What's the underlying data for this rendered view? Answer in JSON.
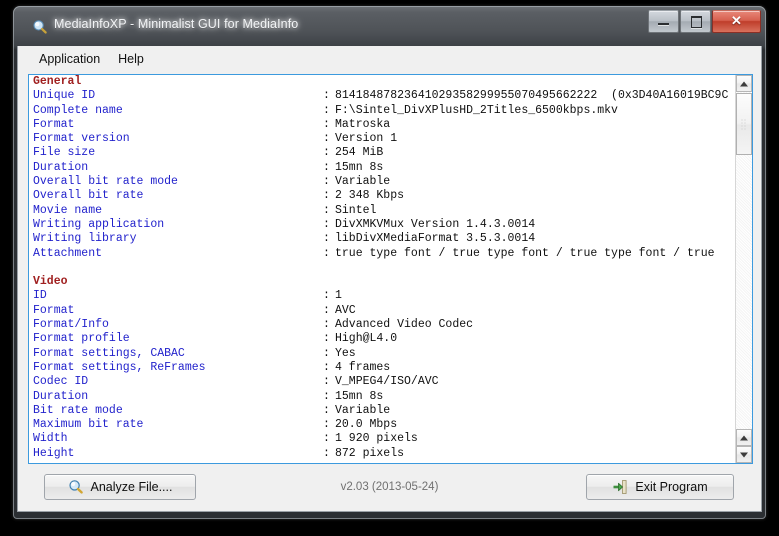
{
  "window": {
    "title": "MediaInfoXP - Minimalist GUI for MediaInfo",
    "app_icon": "magnifier-icon",
    "controls": {
      "minimize_label": "–",
      "maximize_label": "□",
      "close_label": "✕"
    }
  },
  "menubar": {
    "items": [
      {
        "label": "Application"
      },
      {
        "label": "Help"
      }
    ]
  },
  "report": {
    "separator": ":",
    "sections": [
      {
        "name": "General",
        "rows": [
          {
            "label": "Unique ID",
            "value": "81418487823641029358299955070495662222  (0x3D40A16019BC9C"
          },
          {
            "label": "Complete name",
            "value": "F:\\Sintel_DivXPlusHD_2Titles_6500kbps.mkv"
          },
          {
            "label": "Format",
            "value": "Matroska"
          },
          {
            "label": "Format version",
            "value": "Version 1"
          },
          {
            "label": "File size",
            "value": "254 MiB"
          },
          {
            "label": "Duration",
            "value": "15mn 8s"
          },
          {
            "label": "Overall bit rate mode",
            "value": "Variable"
          },
          {
            "label": "Overall bit rate",
            "value": "2 348 Kbps"
          },
          {
            "label": "Movie name",
            "value": "Sintel"
          },
          {
            "label": "Writing application",
            "value": "DivXMKVMux Version 1.4.3.0014"
          },
          {
            "label": "Writing library",
            "value": "libDivXMediaFormat 3.5.3.0014"
          },
          {
            "label": "Attachment",
            "value": "true type font / true type font / true type font / true"
          }
        ]
      },
      {
        "name": "Video",
        "rows": [
          {
            "label": "ID",
            "value": "1"
          },
          {
            "label": "Format",
            "value": "AVC"
          },
          {
            "label": "Format/Info",
            "value": "Advanced Video Codec"
          },
          {
            "label": "Format profile",
            "value": "High@L4.0"
          },
          {
            "label": "Format settings, CABAC",
            "value": "Yes"
          },
          {
            "label": "Format settings, ReFrames",
            "value": "4 frames"
          },
          {
            "label": "Codec ID",
            "value": "V_MPEG4/ISO/AVC"
          },
          {
            "label": "Duration",
            "value": "15mn 8s"
          },
          {
            "label": "Bit rate mode",
            "value": "Variable"
          },
          {
            "label": "Maximum bit rate",
            "value": "20.0 Mbps"
          },
          {
            "label": "Width",
            "value": "1 920 pixels"
          },
          {
            "label": "Height",
            "value": "872 pixels"
          }
        ]
      }
    ]
  },
  "scrollbar": {
    "up_arrow": "scroll-up-icon",
    "down_arrow": "scroll-down-icon"
  },
  "bottombar": {
    "analyze_label": "Analyze File....",
    "analyze_icon": "magnifier-icon",
    "exit_label": "Exit Program",
    "exit_icon": "exit-door-icon",
    "version": "v2.03 (2013-05-24)"
  },
  "colors": {
    "label_blue": "#2222cc",
    "section_red": "#a02020",
    "value_black": "#101010",
    "focus_border": "#3c9ade",
    "close_red": "#bf3d2a",
    "chrome_gray": "#f0f0f0"
  }
}
